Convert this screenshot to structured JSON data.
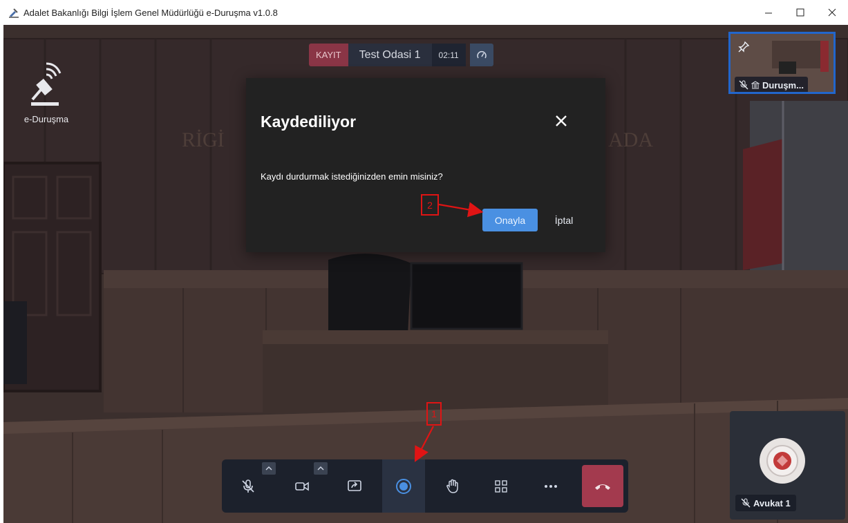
{
  "window": {
    "title": "Adalet Bakanlığı Bilgi İşlem Genel Müdürlüğü e-Duruşma v1.0.8",
    "minimize_icon": "minimize-icon",
    "maximize_icon": "maximize-icon",
    "close_icon": "close-icon"
  },
  "logo": {
    "label": "e-Duruşma"
  },
  "topbar": {
    "record_badge": "KAYIT",
    "room_name": "Test Odasi 1",
    "timer": "02:11",
    "speed_icon": "speedometer-icon"
  },
  "dialog": {
    "title": "Kaydediliyor",
    "message": "Kaydı durdurmak istediğinizden emin misiniz?",
    "confirm_label": "Onayla",
    "cancel_label": "İptal"
  },
  "annotations": {
    "step_1": "1",
    "step_2": "2",
    "color": "#e01414"
  },
  "participants": [
    {
      "name": "Duruşm...",
      "muted": true,
      "pinned": true
    },
    {
      "name": "Avukat 1",
      "muted": true
    }
  ],
  "toolbar": {
    "buttons": [
      "microphone-muted-icon",
      "camera-icon",
      "screen-share-icon",
      "record-icon",
      "raise-hand-icon",
      "grid-view-icon",
      "more-icon",
      "hang-up-icon"
    ],
    "record_active": true,
    "hangup_color": "#a33a4e",
    "accent": "#4a90e2"
  }
}
